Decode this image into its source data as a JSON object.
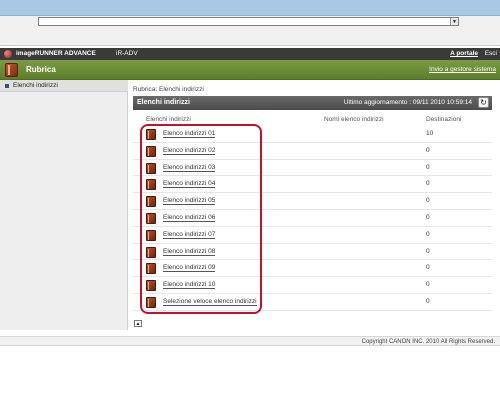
{
  "browser": {
    "address_value": "",
    "dropdown_arrow": "▼"
  },
  "app_header": {
    "brand": "imageRUNNER ADVANCE",
    "device": "iR-ADV",
    "portal_link": "A portale",
    "exit_link": "Esci"
  },
  "title_bar": {
    "title": "Rubrica",
    "system_link": "Invio a gestore sistema"
  },
  "sidebar": {
    "items": [
      {
        "label": "Elenchi indirizzi"
      }
    ]
  },
  "breadcrumb": "Rubrica: Elenchi indirizzi",
  "panel": {
    "title": "Elenchi indirizzi",
    "last_update": "Ultimo aggiornamento : 09/11 2010 10:59:14",
    "refresh_icon": "↻"
  },
  "table": {
    "columns": [
      "Elenchi indirizzi",
      "Nomi elenco indirizzi",
      "Destinazioni"
    ],
    "rows": [
      {
        "name": "Elenco indirizzi 01",
        "alias": "",
        "destinations": "10"
      },
      {
        "name": "Elenco indirizzi 02",
        "alias": "",
        "destinations": "0"
      },
      {
        "name": "Elenco indirizzi 03",
        "alias": "",
        "destinations": "0"
      },
      {
        "name": "Elenco indirizzi 04",
        "alias": "",
        "destinations": "0"
      },
      {
        "name": "Elenco indirizzi 05",
        "alias": "",
        "destinations": "0"
      },
      {
        "name": "Elenco indirizzi 06",
        "alias": "",
        "destinations": "0"
      },
      {
        "name": "Elenco indirizzi 07",
        "alias": "",
        "destinations": "0"
      },
      {
        "name": "Elenco indirizzi 08",
        "alias": "",
        "destinations": "0"
      },
      {
        "name": "Elenco indirizzi 09",
        "alias": "",
        "destinations": "0"
      },
      {
        "name": "Elenco indirizzi 10",
        "alias": "",
        "destinations": "0"
      },
      {
        "name": "Selezione veloce elenco indirizzi",
        "alias": "",
        "destinations": "0"
      }
    ]
  },
  "collapse_icon": "▲",
  "footer": {
    "copyright": "Copyright CANON INC. 2010 All Rights Reserved."
  },
  "colors": {
    "header_bg": "#3a3a3a",
    "title_bar": "#6b8c38",
    "panel_header": "#5a5a5a",
    "highlight": "#c8102e",
    "browser_bar": "#a9c8e8"
  },
  "icons": {
    "brand": "canon-logo-icon",
    "title": "address-book-icon",
    "row": "address-book-icon",
    "refresh": "refresh-icon",
    "collapse": "scroll-top-icon",
    "sidebar_bullet": "square-bullet-icon"
  }
}
